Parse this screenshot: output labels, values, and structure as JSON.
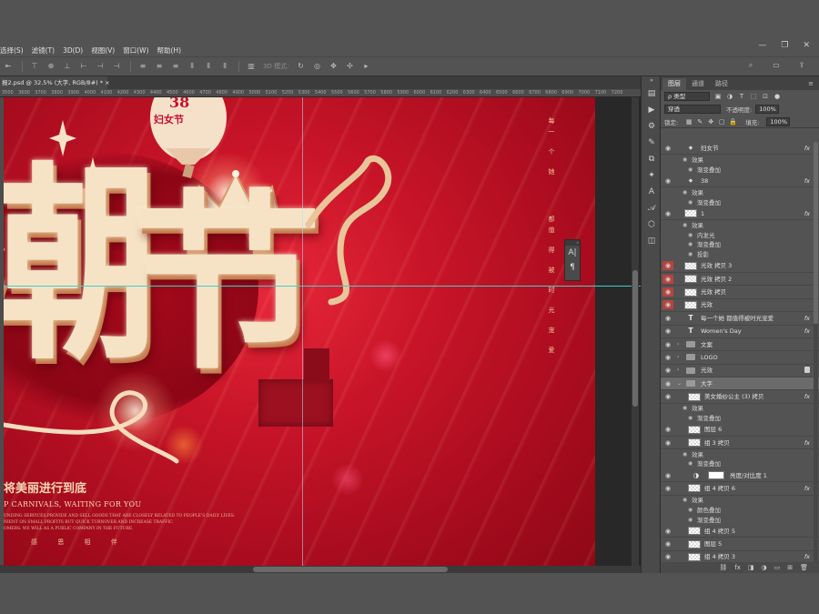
{
  "menu": [
    "选择(S)",
    "滤镜(T)",
    "3D(D)",
    "视图(V)",
    "窗口(W)",
    "帮助(H)"
  ],
  "window_controls": [
    "—",
    "❐",
    "✕"
  ],
  "options_bar": {
    "mode_label": "3D 模式:"
  },
  "document_tab": {
    "title": "报2.psd @ 32.5% (大字, RGB/8#) *",
    "close": "×"
  },
  "ruler_ticks": [
    "3500",
    "3600",
    "3700",
    "3800",
    "3900",
    "4000",
    "4100",
    "4200",
    "4300",
    "4400",
    "4500",
    "4600",
    "4700",
    "4800",
    "4900",
    "5000",
    "5100",
    "5200",
    "5300",
    "5400",
    "5500",
    "5600",
    "5700",
    "5800",
    "5900",
    "6000",
    "6100",
    "6200",
    "6300",
    "6400",
    "6500",
    "6600",
    "6700",
    "6800",
    "6900",
    "7000",
    "7100",
    "7200"
  ],
  "poster": {
    "big_left": "潮",
    "big_right": "节",
    "badge_number": "38",
    "badge_label": "妇女节",
    "subtitle_cn": "将美丽进行到底",
    "subtitle_en": "P CARNIVALS, WAITING FOR YOU",
    "small_en_1": "UNDING SERVICES,PROVIDE AND SELL GOODS THAT ARE CLOSELY RELATED TO PEOPLE'S DAILY LIVES.",
    "small_en_2": "NIENT ON SMALL PROFITS BUT QUICK TURNOVER AND INCREASE TRAFFIC.",
    "small_en_3": "OMERS. WE WILL AS A PUBLIC COMPANY IN THE FUTURE.",
    "footer_chars": [
      "感",
      "恩",
      "相",
      "伴"
    ],
    "vertical_chars_1": [
      "每",
      "一",
      "个",
      "她"
    ],
    "vertical_chars_2": [
      "都",
      "值",
      "得",
      "被",
      "时",
      "光",
      "宠",
      "爱"
    ]
  },
  "float_panel": {
    "btn1": "A|",
    "btn2": "¶"
  },
  "layers_panel": {
    "tabs": [
      "图层",
      "通道",
      "路径"
    ],
    "kind_filter": "ρ 类型",
    "blend_mode": "穿透",
    "opacity_label": "不透明度:",
    "opacity_value": "100%",
    "lock_label": "锁定:",
    "fill_label": "填充:",
    "fill_value": "100%",
    "layers": [
      {
        "kind": "shape",
        "name": "妇女节",
        "fx": "fx",
        "visible": true
      },
      {
        "kind": "sub",
        "name": "效果",
        "indent": 1
      },
      {
        "kind": "sub",
        "name": "渐变叠加",
        "indent": 2
      },
      {
        "kind": "shape",
        "name": "38",
        "fx": "fx",
        "visible": true
      },
      {
        "kind": "sub",
        "name": "效果",
        "indent": 1
      },
      {
        "kind": "sub",
        "name": "渐变叠加",
        "indent": 2
      },
      {
        "kind": "pixel",
        "name": "1",
        "fx": "fx",
        "visible": true
      },
      {
        "kind": "sub",
        "name": "效果",
        "indent": 1
      },
      {
        "kind": "sub",
        "name": "内发光",
        "indent": 2
      },
      {
        "kind": "sub",
        "name": "渐变叠加",
        "indent": 2
      },
      {
        "kind": "sub",
        "name": "投影",
        "indent": 2
      },
      {
        "kind": "pixel",
        "name": "光效 拷贝 3",
        "visible": true,
        "red": true
      },
      {
        "kind": "pixel",
        "name": "光效 拷贝 2",
        "visible": true,
        "red": true
      },
      {
        "kind": "pixel",
        "name": "光效 拷贝",
        "visible": true,
        "red": true
      },
      {
        "kind": "pixel",
        "name": "光效",
        "visible": true,
        "red": true
      },
      {
        "kind": "text",
        "name": "每一个她 都值得被时光宠爱",
        "fx": "fx",
        "visible": true
      },
      {
        "kind": "text",
        "name": "Women's Day",
        "fx": "fx",
        "visible": true
      },
      {
        "kind": "group",
        "name": "文案",
        "visible": true
      },
      {
        "kind": "group",
        "name": "LOGO",
        "visible": true
      },
      {
        "kind": "group",
        "name": "光效",
        "visible": true,
        "locked": true
      },
      {
        "kind": "group",
        "name": "大字",
        "visible": true,
        "selected": true,
        "open": true
      },
      {
        "kind": "pixel",
        "name": "美女婚纱公主 (3) 拷贝",
        "fx": "fx",
        "visible": true,
        "child": true
      },
      {
        "kind": "sub",
        "name": "效果",
        "indent": 1
      },
      {
        "kind": "sub",
        "name": "渐变叠加",
        "indent": 2
      },
      {
        "kind": "pixel",
        "name": "图层 6",
        "visible": true,
        "child": true
      },
      {
        "kind": "pixel",
        "name": "组 3 拷贝",
        "fx": "fx",
        "visible": true,
        "child": true
      },
      {
        "kind": "sub",
        "name": "效果",
        "indent": 1
      },
      {
        "kind": "sub",
        "name": "渐变叠加",
        "indent": 2
      },
      {
        "kind": "adjust",
        "name": "亮度/对比度 1",
        "visible": true,
        "child": true
      },
      {
        "kind": "pixel",
        "name": "组 4 拷贝 6",
        "fx": "fx",
        "visible": true,
        "child": true
      },
      {
        "kind": "sub",
        "name": "效果",
        "indent": 1
      },
      {
        "kind": "sub",
        "name": "颜色叠加",
        "indent": 2
      },
      {
        "kind": "sub",
        "name": "渐变叠加",
        "indent": 2
      },
      {
        "kind": "pixel",
        "name": "组 4 拷贝 5",
        "visible": true,
        "child": true
      },
      {
        "kind": "pixel",
        "name": "图层 5",
        "visible": true,
        "child": true
      },
      {
        "kind": "pixel",
        "name": "组 4 拷贝 3",
        "fx": "fx",
        "visible": true,
        "child": true
      }
    ],
    "bottom_icons": [
      "⛓",
      "fx",
      "◨",
      "◑",
      "▭",
      "⊞",
      "🗑"
    ]
  },
  "colors": {
    "poster_red": "#c81428",
    "gold": "#f6e3c6",
    "guide": "#3fd0c8",
    "eye_red": "#b5443f"
  }
}
